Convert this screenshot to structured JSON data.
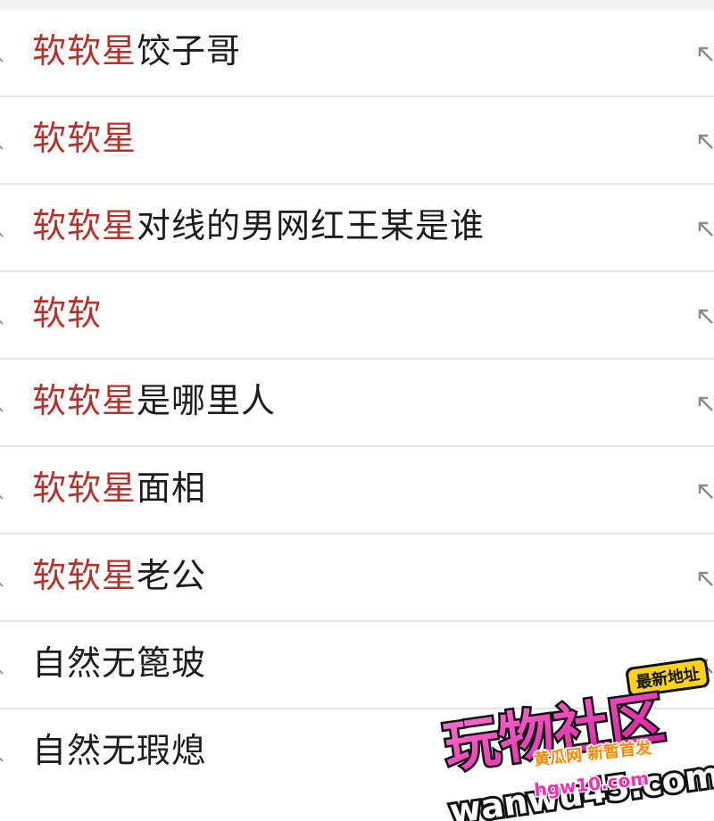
{
  "suggestions": [
    {
      "highlight": "软软星",
      "rest": "饺子哥"
    },
    {
      "highlight": "软软星",
      "rest": ""
    },
    {
      "highlight": "软软星",
      "rest": "对线的男网红王某是谁"
    },
    {
      "highlight": "软软",
      "rest": ""
    },
    {
      "highlight": "软软星",
      "rest": "是哪里人"
    },
    {
      "highlight": "软软星",
      "rest": "面相"
    },
    {
      "highlight": "软软星",
      "rest": "老公"
    },
    {
      "highlight": "",
      "rest": "自然无篦玻"
    },
    {
      "highlight": "",
      "rest": "自然无瑕熄"
    }
  ],
  "icons": {
    "leading": "search-icon",
    "trailing": "arrow-up-left-icon"
  },
  "colors": {
    "highlight": "#b5312c",
    "text": "#1c1c1c",
    "divider": "#e6e6e6"
  },
  "watermark": {
    "title": "玩物社区",
    "badge": "最新地址",
    "slogan": "黄瓜网 新暂首发",
    "domain": "wanwu45.com",
    "subdomain": "hgw10.com"
  }
}
